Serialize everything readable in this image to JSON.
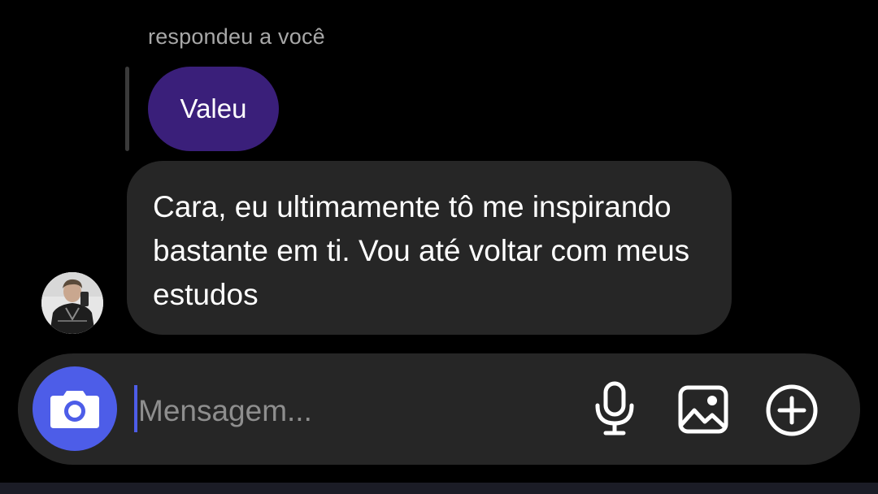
{
  "reply": {
    "header": "respondeu a você",
    "quoted_text": "Valeu"
  },
  "message": {
    "text": "Cara, eu ultimamente tô me inspirando bastante em ti. Vou até voltar com meus estudos"
  },
  "composer": {
    "placeholder": "Mensagem...",
    "value": ""
  },
  "icons": {
    "camera": "camera-icon",
    "mic": "microphone-icon",
    "gallery": "image-gallery-icon",
    "add": "plus-circle-icon"
  },
  "colors": {
    "background": "#000000",
    "replied_bubble": "#3a1f7a",
    "message_bubble": "#262626",
    "accent": "#4d5de8",
    "muted_text": "#a8a8a8"
  }
}
